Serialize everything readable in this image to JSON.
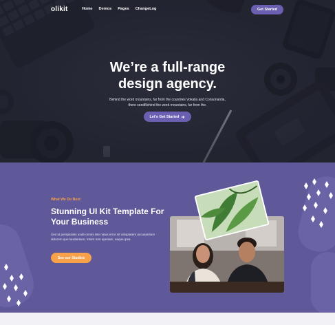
{
  "header": {
    "logo": "olikit",
    "menu": [
      "Home",
      "Demos",
      "Pages",
      "ChangeLog"
    ],
    "cta": "Get Started"
  },
  "hero": {
    "title_line1": "We’re a full-range",
    "title_line2": "design agency.",
    "subtitle_line1": "Behind the word mountains, far from the countries Vokalia and Consonantia,",
    "subtitle_line2": "there seedBehind the word mountains, far from the.",
    "cta": "Let’s Get Started",
    "cta_icon": "arrow-right-icon"
  },
  "services": {
    "eyebrow": "What We Do Best",
    "title": "Stunning UI Kit Template For Your Business",
    "body": "Sed ut perspiciatis unde omnis iste natus error sit voluptatem accusantium dolorem que laudantium, totam rem aperiam, eaque ipsa.",
    "cta": "See our Studios"
  },
  "colors": {
    "accent": "#6a5fb0",
    "orange": "#f7a24a",
    "section_bg": "#5f5899",
    "hero_bg": "#2a2c3a"
  }
}
